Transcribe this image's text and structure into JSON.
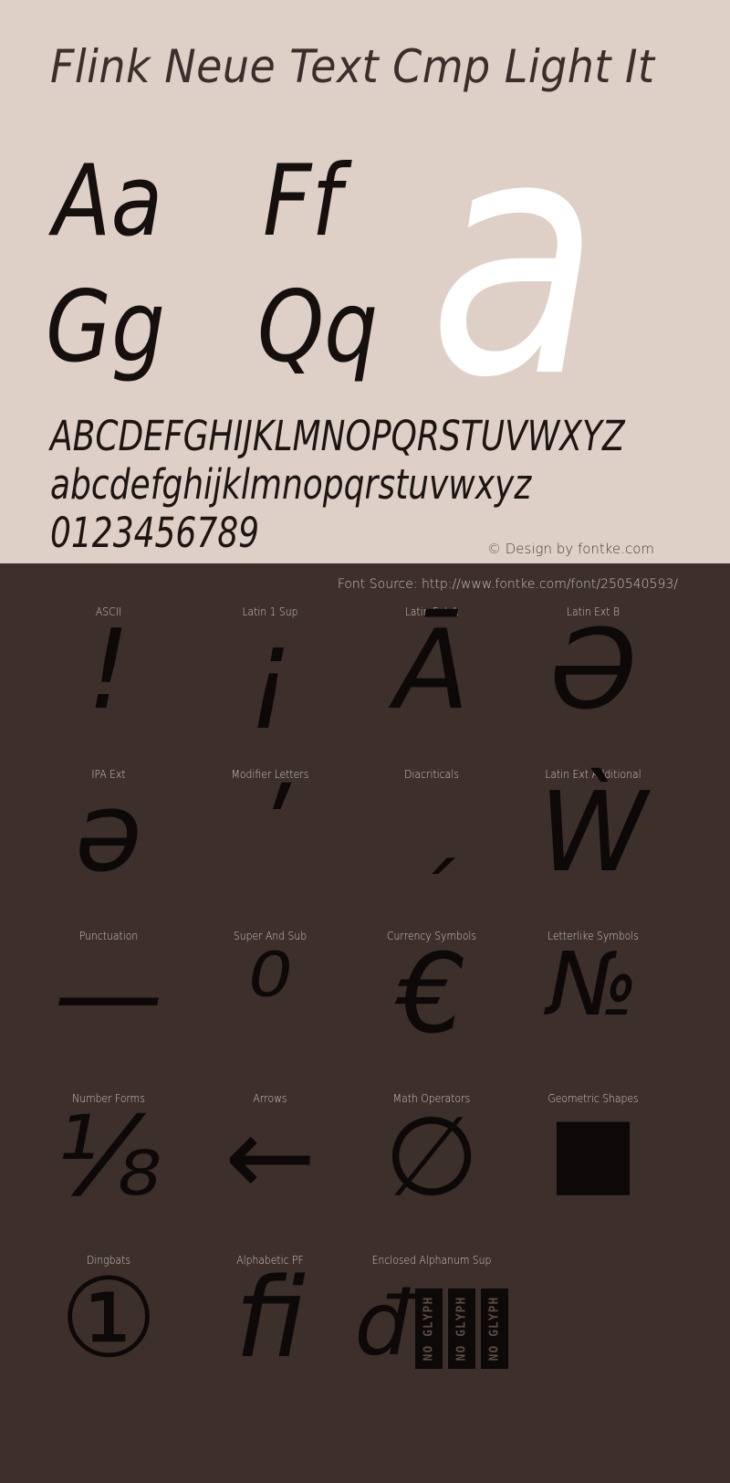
{
  "colors": {
    "top_background": "#ded0c6",
    "bottom_background": "#3d302b",
    "glyph_black": "#0d0908",
    "hero_white": "#ffffff",
    "label_text": "#d2c7c0"
  },
  "header": {
    "font_title": "Flink Neue Text Cmp Light It"
  },
  "showcase": {
    "pairs": [
      {
        "label": "Aa"
      },
      {
        "label": "Ff"
      },
      {
        "label": "Gg"
      },
      {
        "label": "Qq"
      }
    ],
    "hero_glyph": "a"
  },
  "alphabet": {
    "uppercase": "ABCDEFGHIJKLMNOPQRSTUVWXYZ",
    "lowercase": "abcdefghijklmnopqrstuvwxyz",
    "digits": "0123456789"
  },
  "credit": "© Design by fontke.com",
  "source": "Font Source: http://www.fontke.com/font/250540593/",
  "unicode_blocks": {
    "rows": [
      [
        {
          "label": "ASCII",
          "sample": "!",
          "size": "normal"
        },
        {
          "label": "Latin 1 Sup",
          "sample": "¡",
          "size": "normal"
        },
        {
          "label": "Latin Ext A",
          "sample": "Ā",
          "size": "normal"
        },
        {
          "label": "Latin Ext B",
          "sample": "Ə",
          "size": "normal"
        }
      ],
      [
        {
          "label": "IPA Ext",
          "sample": "ə",
          "size": "normal"
        },
        {
          "label": "Modifier Letters",
          "sample": "ʹ",
          "size": "normal"
        },
        {
          "label": "Diacriticals",
          "sample": "ˏ",
          "size": "small"
        },
        {
          "label": "Latin Ext Additional",
          "sample": "Ẁ",
          "size": "normal"
        }
      ],
      [
        {
          "label": "Punctuation",
          "sample": "—",
          "size": "normal"
        },
        {
          "label": "Super And Sub",
          "sample": "⁰",
          "size": "normal"
        },
        {
          "label": "Currency Symbols",
          "sample": "€",
          "size": "normal"
        },
        {
          "label": "Letterlike Symbols",
          "sample": "№",
          "size": "small"
        }
      ],
      [
        {
          "label": "Number Forms",
          "sample": "⅛",
          "size": "normal"
        },
        {
          "label": "Arrows",
          "sample": "←",
          "size": "normal"
        },
        {
          "label": "Math Operators",
          "sample": "∅",
          "size": "normal"
        },
        {
          "label": "Geometric Shapes",
          "sample": "■",
          "size": "shape"
        }
      ],
      [
        {
          "label": "Dingbats",
          "sample": "①",
          "size": "normal"
        },
        {
          "label": "Alphabetic PF",
          "sample": "ﬁ",
          "size": "normal"
        },
        {
          "label": "Enclosed Alphanum Sup",
          "sample": "đ",
          "size": "noglyph"
        },
        {
          "label": "",
          "sample": "",
          "size": "empty"
        }
      ]
    ],
    "no_glyph_label": "NO GLYPH",
    "no_glyph_count": 3
  }
}
